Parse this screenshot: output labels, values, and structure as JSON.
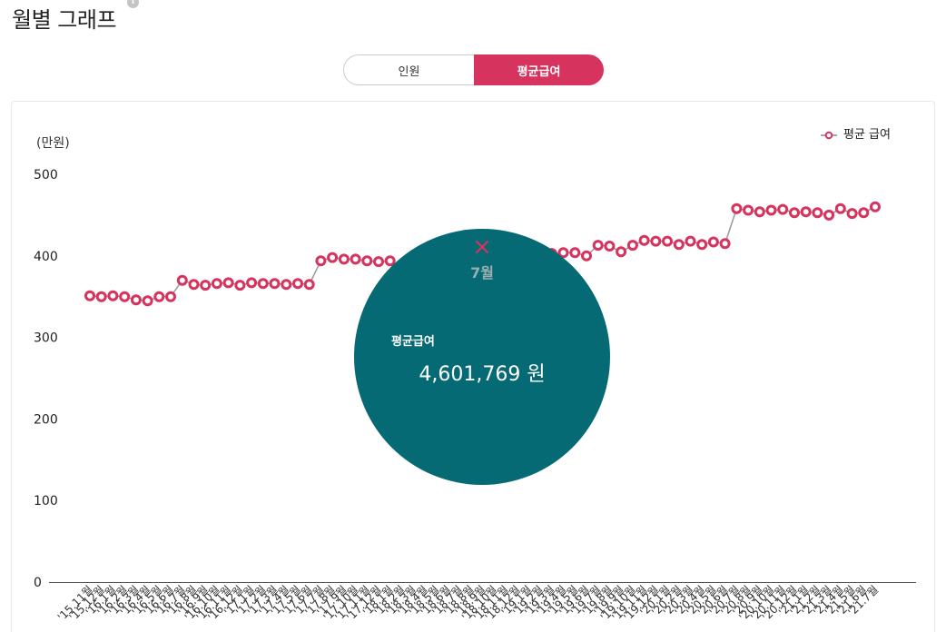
{
  "header": {
    "info_icon": "info-icon"
  },
  "toggle": {
    "active_color": "#d6335e",
    "options": [
      {
        "label": "인원",
        "selected": false
      },
      {
        "label": "평균급여",
        "selected": true
      }
    ]
  },
  "chart_data": {
    "type": "line",
    "title": "월별 그래프",
    "ylabel": "(만원)",
    "ylim": [
      0,
      500
    ],
    "yticks": [
      0,
      100,
      200,
      300,
      400,
      500
    ],
    "grid": false,
    "legend": "top-right",
    "categories": [
      "'15.11월",
      "'15.12월",
      "'16.1월",
      "'16.2월",
      "'16.3월",
      "'16.4월",
      "'16.5월",
      "'16.6월",
      "'16.7월",
      "'16.8월",
      "'16.9월",
      "'16.10월",
      "'16.11월",
      "'16.12월",
      "'17.1월",
      "'17.2월",
      "'17.3월",
      "'17.4월",
      "'17.5월",
      "'17.6월",
      "'17.7월",
      "'17.8월",
      "'17.9월",
      "'17.10월",
      "'17.11월",
      "'17.12월",
      "'18.1월",
      "'18.2월",
      "'18.3월",
      "'18.4월",
      "'18.5월",
      "'18.6월",
      "'18.7월",
      "'18.8월",
      "'18.9월",
      "'18.10월",
      "'18.11월",
      "'18.12월",
      "'19.1월",
      "'19.2월",
      "'19.3월",
      "'19.4월",
      "'19.5월",
      "'19.6월",
      "'19.7월",
      "'19.8월",
      "'19.9월",
      "'19.10월",
      "'19.11월",
      "'19.12월",
      "'20.1월",
      "'20.2월",
      "'20.3월",
      "'20.4월",
      "'20.5월",
      "'20.6월",
      "'20.7월",
      "'20.8월",
      "'20.9월",
      "'20.10월",
      "'20.11월",
      "'20.12월",
      "'21.1월",
      "'21.2월",
      "'21.3월",
      "'21.4월",
      "'21.5월",
      "'21.6월",
      "'21.7월"
    ],
    "series": [
      {
        "name": "평균 급여",
        "color": "#d6335e",
        "line_color": "#999999",
        "values": [
          351,
          350,
          351,
          350,
          346,
          345,
          350,
          350,
          370,
          365,
          364,
          366,
          367,
          364,
          367,
          366,
          366,
          365,
          366,
          365,
          394,
          398,
          396,
          396,
          394,
          393,
          394,
          null,
          null,
          null,
          null,
          null,
          null,
          null,
          null,
          null,
          null,
          null,
          null,
          null,
          403,
          404,
          404,
          400,
          413,
          412,
          405,
          413,
          419,
          418,
          418,
          414,
          418,
          414,
          417,
          415,
          458,
          456,
          454,
          456,
          457,
          453,
          454,
          453,
          450,
          458,
          452,
          453,
          460.2
        ]
      }
    ]
  },
  "tooltip": {
    "close_icon": "close-icon",
    "close_color": "#d6335e",
    "bg_color": "#066a74",
    "month": "7월",
    "label": "평균급여",
    "value": "4,601,769 원"
  }
}
